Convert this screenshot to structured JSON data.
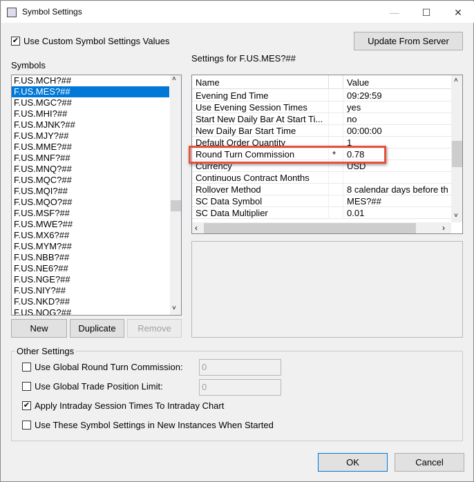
{
  "window": {
    "title": "Symbol Settings",
    "minimize": "—",
    "maximize": "☐",
    "close": "✕"
  },
  "use_custom": {
    "label": "Use Custom Symbol Settings Values",
    "checked": true
  },
  "update_button": "Update From Server",
  "symbols_label": "Symbols",
  "symbols": [
    "F.US.MCH?##",
    "F.US.MES?##",
    "F.US.MGC?##",
    "F.US.MHI?##",
    "F.US.MJNK?##",
    "F.US.MJY?##",
    "F.US.MME?##",
    "F.US.MNF?##",
    "F.US.MNQ?##",
    "F.US.MQC?##",
    "F.US.MQI?##",
    "F.US.MQO?##",
    "F.US.MSF?##",
    "F.US.MWE?##",
    "F.US.MX6?##",
    "F.US.MYM?##",
    "F.US.NBB?##",
    "F.US.NE6?##",
    "F.US.NGE?##",
    "F.US.NIY?##",
    "F.US.NKD?##",
    "F.US.NQG?##"
  ],
  "selected_symbol": "F.US.MES?##",
  "list_buttons": {
    "new": "New",
    "duplicate": "Duplicate",
    "remove": "Remove"
  },
  "settings_title": "Settings for F.US.MES?##",
  "grid": {
    "headers": {
      "name": "Name",
      "value": "Value"
    },
    "rows": [
      {
        "name": "Evening End Time",
        "mark": "",
        "value": "09:29:59"
      },
      {
        "name": "Use Evening Session Times",
        "mark": "",
        "value": "yes"
      },
      {
        "name": "Start New Daily Bar At Start Ti...",
        "mark": "",
        "value": "no"
      },
      {
        "name": "New Daily Bar Start Time",
        "mark": "",
        "value": "00:00:00"
      },
      {
        "name": "Default Order Quantity",
        "mark": "",
        "value": "1"
      },
      {
        "name": "Round Turn Commission",
        "mark": "*",
        "value": "0.78"
      },
      {
        "name": "Currency",
        "mark": "",
        "value": "USD"
      },
      {
        "name": "Continuous Contract Months",
        "mark": "",
        "value": ""
      },
      {
        "name": "Rollover Method",
        "mark": "",
        "value": "8 calendar days before th"
      },
      {
        "name": "SC Data Symbol",
        "mark": "",
        "value": "MES?##"
      },
      {
        "name": "SC Data Multiplier",
        "mark": "",
        "value": "0.01"
      }
    ],
    "highlight_color": "#e8503a"
  },
  "other": {
    "title": "Other Settings",
    "global_commission": {
      "label": "Use Global Round Turn Commission:",
      "checked": false,
      "value": "0"
    },
    "global_limit": {
      "label": "Use Global Trade Position Limit:",
      "checked": false,
      "value": "0"
    },
    "intraday": {
      "label": "Apply Intraday Session Times To Intraday Chart",
      "checked": true
    },
    "new_instances": {
      "label": "Use These Symbol Settings in New Instances When Started",
      "checked": false
    }
  },
  "ok": "OK",
  "cancel": "Cancel"
}
